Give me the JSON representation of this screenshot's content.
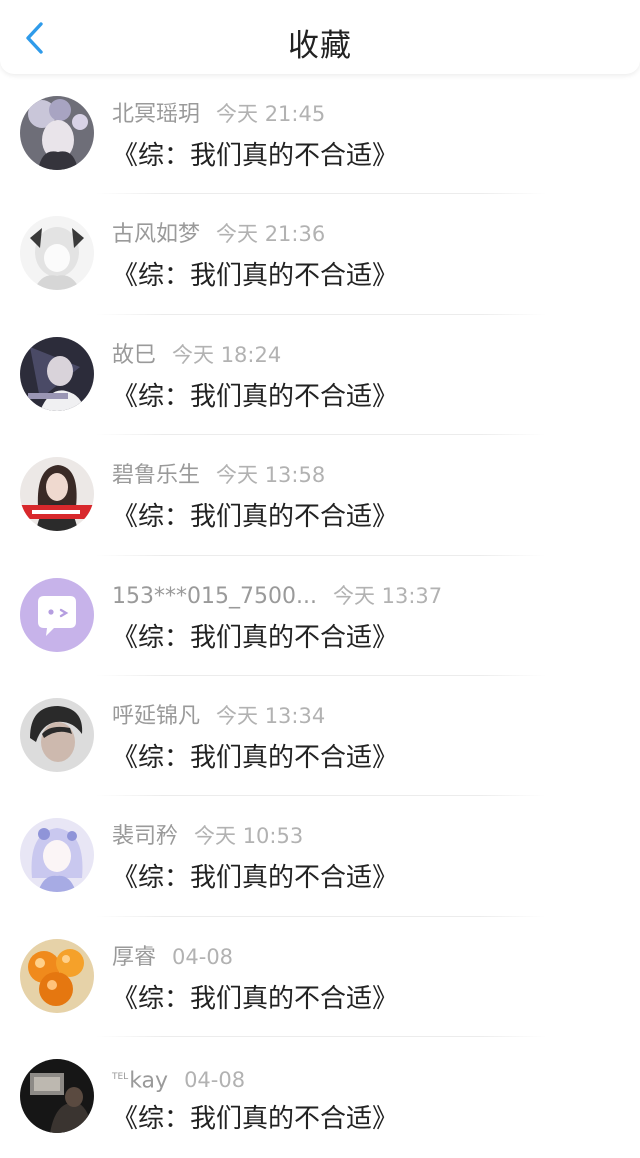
{
  "header": {
    "title": "收藏",
    "back_icon": "chevron-left-icon",
    "accent": "#2f9bea"
  },
  "items": [
    {
      "name": "北冥瑶玥",
      "time": "今天 21:45",
      "message": "《综：我们真的不合适》"
    },
    {
      "name": "古风如梦",
      "time": "今天 21:36",
      "message": "《综：我们真的不合适》"
    },
    {
      "name": "故巳",
      "time": "今天 18:24",
      "message": "《综：我们真的不合适》"
    },
    {
      "name": "碧鲁乐生",
      "time": "今天 13:58",
      "message": "《综：我们真的不合适》"
    },
    {
      "name": "153***015_7500...",
      "time": "今天 13:37",
      "message": "《综：我们真的不合适》"
    },
    {
      "name": "呼延锦凡",
      "time": "今天 13:34",
      "message": "《综：我们真的不合适》"
    },
    {
      "name": "裴司矜",
      "time": "今天 10:53",
      "message": "《综：我们真的不合适》"
    },
    {
      "name": "厚睿",
      "time": "04-08",
      "message": "《综：我们真的不合适》"
    },
    {
      "name": "kay",
      "name_prefix": "TEL",
      "time": "04-08",
      "message": "《综：我们真的不合适》"
    }
  ],
  "colors": {
    "name": "#9a9a9a",
    "time": "#b2b2b2",
    "message": "#222222",
    "default_avatar_bg": "#c7b3ea"
  }
}
